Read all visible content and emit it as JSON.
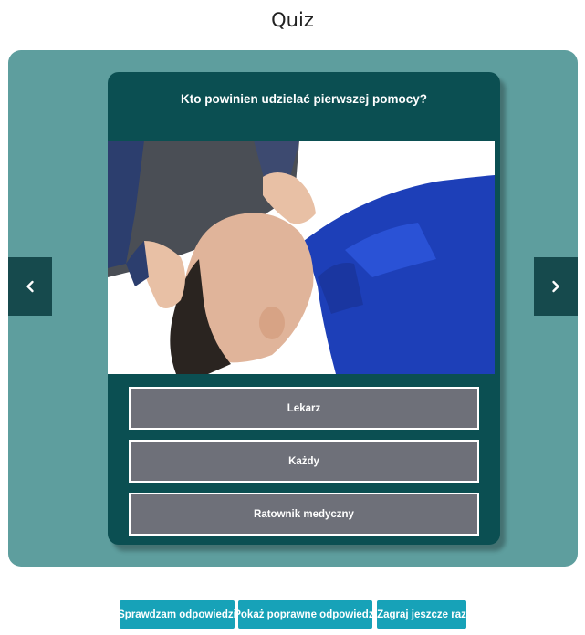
{
  "page": {
    "title": "Quiz"
  },
  "navigation": {
    "prev_icon": "chevron-left-icon",
    "next_icon": "chevron-right-icon"
  },
  "quiz": {
    "question": "Kto powinien udzielać pierwszej pomocy?",
    "image": "first-aid-photo",
    "answers": [
      "Lekarz",
      "Każdy",
      "Ratownik medyczny"
    ]
  },
  "actions": {
    "check": "Sprawdzam odpowiedzi",
    "show_correct": "Pokaż poprawne odpowiedzi",
    "play_again": "Zagraj jeszcze raz"
  },
  "colors": {
    "stage": "#5e9e9e",
    "card": "#0b4f52",
    "nav_button": "#164a4d",
    "answer": "#6e7079",
    "action_button": "#17a2b8"
  }
}
